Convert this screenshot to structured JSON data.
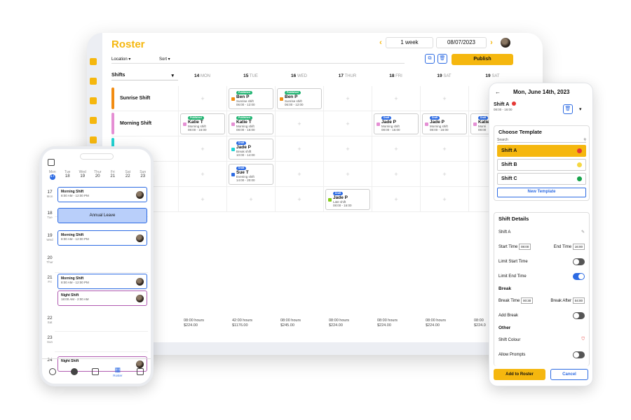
{
  "colors": {
    "accent": "#f5b70f",
    "primary": "#2d6be3"
  },
  "tablet": {
    "title": "Roster",
    "view": "1 week",
    "date": "08/07/2023",
    "prev_icon": "chevron-left-icon",
    "next_icon": "chevron-right-icon",
    "filters": {
      "location": "Location",
      "sort": "Sort"
    },
    "publish": "Publish",
    "shift_select": "Shifts",
    "days": [
      {
        "num": "14",
        "name": "MON"
      },
      {
        "num": "15",
        "name": "TUE"
      },
      {
        "num": "16",
        "name": "WED"
      },
      {
        "num": "17",
        "name": "THUR"
      },
      {
        "num": "18",
        "name": "FRI"
      },
      {
        "num": "19",
        "name": "SAT"
      },
      {
        "num": "19",
        "name": "SAT"
      }
    ],
    "rows": [
      {
        "label": "Sunrise Shift",
        "color": "#f28c12"
      },
      {
        "label": "Morning Shift",
        "color": "#e58fd4"
      },
      {
        "label": "",
        "color": "#22d3d3"
      },
      {
        "label": "",
        "color": "#2d6be3"
      },
      {
        "label": "",
        "color": "#84cc16"
      }
    ],
    "cards": {
      "r0c1": {
        "tag": "Published",
        "name": "Ben P",
        "shift": "Sunrise shift",
        "time": "06:00 - 12:00"
      },
      "r0c2": {
        "tag": "Published",
        "name": "Ben P",
        "shift": "Sunrise shift",
        "time": "06:00 - 12:00"
      },
      "r1c0": {
        "tag": "Published",
        "name": "Katie T",
        "shift": "Morning shift",
        "time": "08:00 - 16:00"
      },
      "r1c1": {
        "tag": "Published",
        "name": "Katie T",
        "shift": "Morning shift",
        "time": "08:00 - 16:00"
      },
      "r1c4": {
        "tag": "Draft",
        "name": "Jade P",
        "shift": "Morning shift",
        "time": "08:00 - 16:00"
      },
      "r1c5": {
        "tag": "Draft",
        "name": "Jade P",
        "shift": "Morning shift",
        "time": "08:00 - 16:00"
      },
      "r1c6": {
        "tag": "Draft",
        "name": "Katie",
        "shift": "Morni",
        "time": "08:00"
      },
      "r2c1": {
        "tag": "Draft",
        "name": "Jade P",
        "shift": "Break shift",
        "time": "10:00 - 14:00"
      },
      "r3c1": {
        "tag": "Draft",
        "name": "Sue T",
        "shift": "Evening shift",
        "time": "14:00 - 20:00"
      },
      "r4c3": {
        "tag": "Draft",
        "name": "Jade P",
        "shift": "Late shift",
        "time": "08:00 - 16:00"
      }
    },
    "totals": [
      {
        "hours": "08:00 hours",
        "cost": "$224.00"
      },
      {
        "hours": "42:00 hours",
        "cost": "$1176.00"
      },
      {
        "hours": "08:00 hours",
        "cost": "$245.00"
      },
      {
        "hours": "08:00 hours",
        "cost": "$224.00"
      },
      {
        "hours": "08:00 hours",
        "cost": "$224.00"
      },
      {
        "hours": "08:00 hours",
        "cost": "$224.00"
      },
      {
        "hours": "08:00",
        "cost": "$224.0"
      }
    ]
  },
  "phone": {
    "week": [
      {
        "d": "Mon",
        "n": "17"
      },
      {
        "d": "Tue",
        "n": "18"
      },
      {
        "d": "Wed",
        "n": "19"
      },
      {
        "d": "Thur",
        "n": "20"
      },
      {
        "d": "Fri",
        "n": "21"
      },
      {
        "d": "Sat",
        "n": "22"
      },
      {
        "d": "Sun",
        "n": "23"
      }
    ],
    "days": [
      {
        "n": "17",
        "d": "Mon"
      },
      {
        "n": "18",
        "d": "Tue"
      },
      {
        "n": "19",
        "d": "Wed"
      },
      {
        "n": "20",
        "d": "Thur"
      },
      {
        "n": "21",
        "d": "Fri"
      },
      {
        "n": "22",
        "d": "Sat"
      },
      {
        "n": "23",
        "d": "Sun"
      },
      {
        "n": "24",
        "d": ""
      }
    ],
    "cards": [
      {
        "title": "Morning Shift",
        "time": "8:00 AM - 12:00 PM"
      },
      {
        "title": "Morning Shift",
        "time": "8:00 AM - 12:00 PM"
      },
      {
        "title": "Morning Shift",
        "time": "8:00 AM - 12:00 PM"
      },
      {
        "title": "Night Shift",
        "time": "18:00 AM - 2:00 AM"
      },
      {
        "title": "Night Shift",
        "time": ""
      }
    ],
    "annual_leave": "Annual Leave",
    "nav_roster": "Roster"
  },
  "panel": {
    "back_icon": "arrow-left-icon",
    "date": "Mon, June 14th, 2023",
    "shift_name": "Shift A",
    "shift_time": "08:00 - 16:00",
    "choose_template": "Choose Template",
    "search_placeholder": "Search",
    "templates": [
      {
        "name": "Shift A",
        "color": "#e53935"
      },
      {
        "name": "Shift B",
        "color": "#f5d742"
      },
      {
        "name": "Shift C",
        "color": "#16a34a"
      }
    ],
    "new_template": "New Template",
    "details_head": "Shift Details",
    "detail_name": "Shift A",
    "start_label": "Start Time",
    "start_val": "08:00",
    "end_label": "End Time",
    "end_val": "16:00",
    "limit_start": "Limit Start Time",
    "limit_end": "Limit End Time",
    "break_head": "Break",
    "break_time_label": "Break Time",
    "break_time_val": "00:30",
    "break_after_label": "Break After",
    "break_after_val": "04:00",
    "add_break": "Add Break",
    "other_head": "Other",
    "shift_colour": "Shift Colour",
    "allow_prompts": "Allow Prompts",
    "add_btn": "Add to Roster",
    "cancel_btn": "Cancel"
  }
}
